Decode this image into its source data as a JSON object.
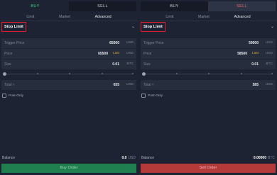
{
  "left": {
    "tabs": {
      "buy": "BUY",
      "sell": "SELL"
    },
    "order_tabs": [
      "Limit",
      "Market",
      "Advanced"
    ],
    "order_type": "Stop Limit",
    "trigger": {
      "label": "Trigger Price",
      "value": "65000",
      "unit": "USD"
    },
    "price": {
      "label": "Price",
      "value": "65500",
      "last": "Last",
      "unit": "USD"
    },
    "size": {
      "label": "Size",
      "value": "0.01",
      "unit": "BTC"
    },
    "total": {
      "label": "Total ≈",
      "value": "655",
      "unit": "USD"
    },
    "post_only": "Post-Only",
    "balance": {
      "label": "Balance",
      "value": "0.0",
      "unit": "USD"
    },
    "submit": "Buy Order"
  },
  "right": {
    "tabs": {
      "buy": "BUY",
      "sell": "SELL"
    },
    "order_tabs": [
      "Limit",
      "Market",
      "Advanced"
    ],
    "order_type": "Stop Limit",
    "trigger": {
      "label": "Trigger Price",
      "value": "59000",
      "unit": "USD"
    },
    "price": {
      "label": "Price",
      "value": "58500",
      "last": "Last",
      "unit": "USD"
    },
    "size": {
      "label": "Size",
      "value": "0.01",
      "unit": "BTC"
    },
    "total": {
      "label": "Total ≈",
      "value": "585",
      "unit": "USD"
    },
    "post_only": "Post-Only",
    "balance": {
      "label": "Balance",
      "value": "0.00000",
      "unit": "BTC"
    },
    "submit": "Sell Order"
  },
  "colors": {
    "buy": "#3bd18a",
    "sell": "#f06a6a",
    "highlight": "#e21e2a",
    "last": "#e5a92c"
  }
}
